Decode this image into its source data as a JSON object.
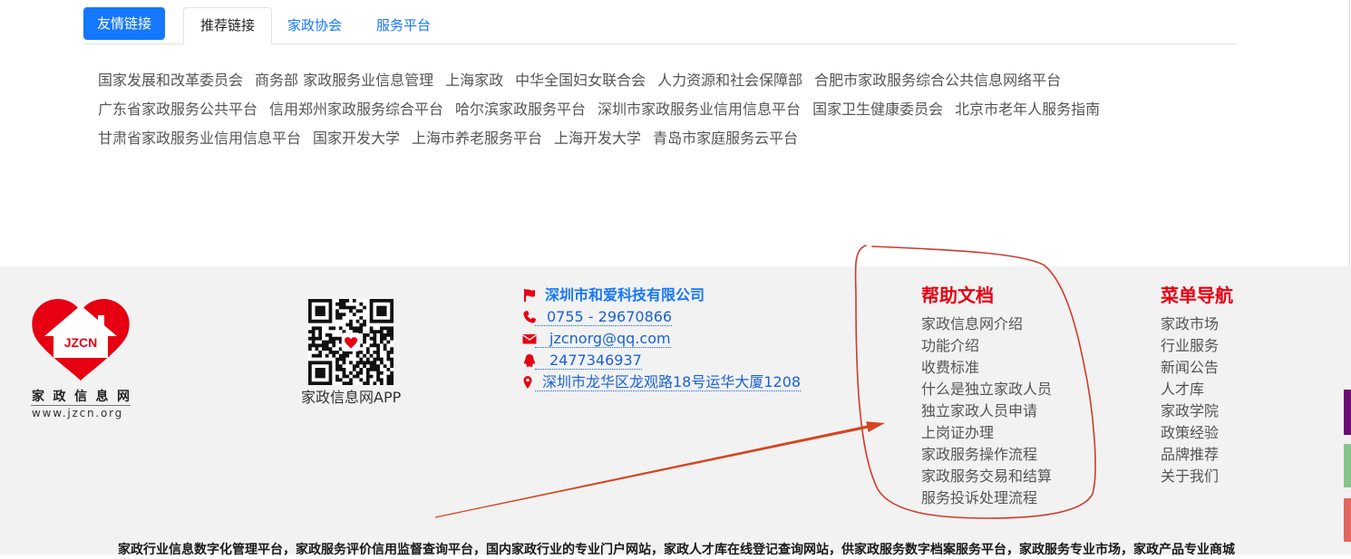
{
  "tabs": {
    "friend_links_button": "友情链接",
    "items": [
      "推荐链接",
      "家政协会",
      "服务平台"
    ],
    "active": "推荐链接"
  },
  "links": {
    "rows": [
      [
        "国家发展和改革委员会",
        "商务部 家政服务业信息管理",
        "上海家政",
        "中华全国妇女联合会",
        "人力资源和社会保障部",
        "合肥市家政服务综合公共信息网络平台"
      ],
      [
        "广东省家政服务公共平台",
        "信用郑州家政服务综合平台",
        "哈尔滨家政服务平台",
        "深圳市家政服务业信用信息平台",
        "国家卫生健康委员会",
        "北京市老年人服务指南"
      ],
      [
        "甘肃省家政服务业信用信息平台",
        "国家开发大学",
        "上海市养老服务平台",
        "上海开发大学",
        "青岛市家庭服务云平台"
      ]
    ]
  },
  "footer": {
    "logo": {
      "badge": "JZCN",
      "name": "家政信息网",
      "domain": "www.jzcn.org"
    },
    "app": {
      "caption": "家政信息网APP"
    },
    "contact": {
      "company": "深圳市和爱科技有限公司",
      "phone": "0755 - 29670866",
      "email": "jzcnorg@qq.com",
      "qq": "2477346937",
      "address": "深圳市龙华区龙观路18号运华大厦1208"
    },
    "help": {
      "title": "帮助文档",
      "items": [
        "家政信息网介绍",
        "功能介绍",
        "收费标准",
        "什么是独立家政人员",
        "独立家政人员申请",
        "上岗证办理",
        "家政服务操作流程",
        "家政服务交易和结算",
        "服务投诉处理流程"
      ]
    },
    "menu": {
      "title": "菜单导航",
      "items": [
        "家政市场",
        "行业服务",
        "新闻公告",
        "人才库",
        "家政学院",
        "政策经验",
        "品牌推荐",
        "关于我们"
      ]
    },
    "tagline": "家政行业信息数字化管理平台，家政服务评价信用监督查询平台，国内家政行业的专业门户网站，家政人才库在线登记查询网站，供家政服务数字档案服务平台，家政服务专业市场，家政产品专业商城"
  },
  "icons": {
    "company": "flag-icon",
    "phone": "phone-icon",
    "email": "mail-icon",
    "qq": "qq-icon",
    "address": "location-icon"
  },
  "colors": {
    "accent_blue": "#1677ff",
    "brand_red": "#e60012",
    "footer_bg": "#f2f2f2",
    "link_gray": "#555555",
    "annotation_red": "#d13a2a",
    "side_buttons": [
      "#6b0d74",
      "#86c58b",
      "#e2675f"
    ]
  }
}
